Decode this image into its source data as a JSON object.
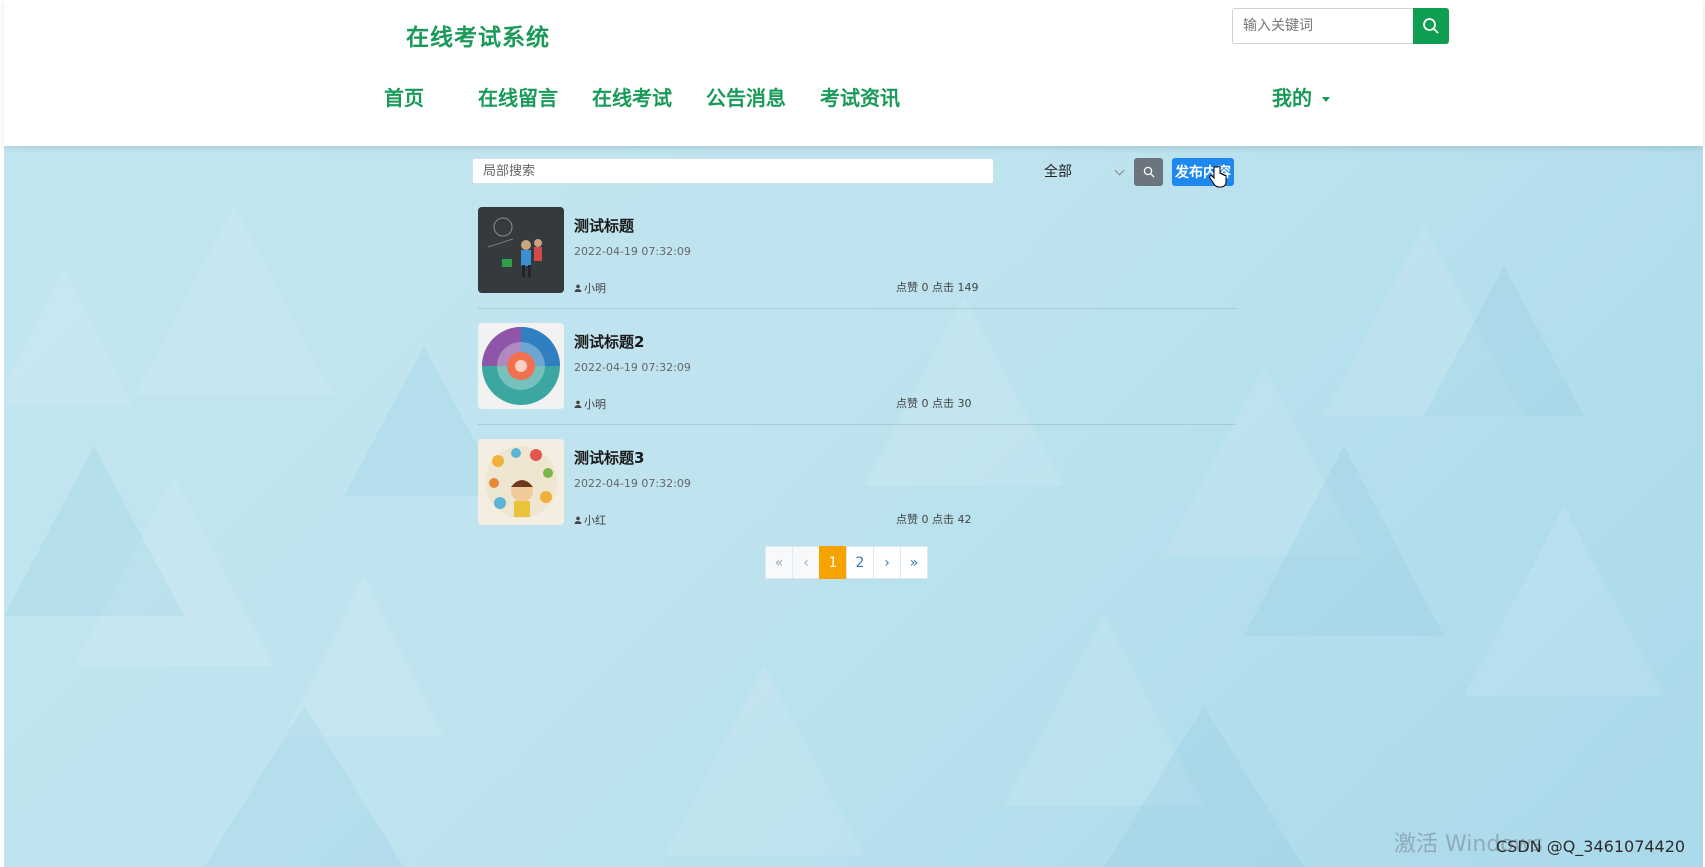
{
  "header": {
    "logo": "在线考试系统",
    "search_placeholder": "输入关键词",
    "nav": [
      "首页",
      "在线留言",
      "在线考试",
      "公告消息",
      "考试资讯"
    ],
    "mine": "我的"
  },
  "toolbar": {
    "local_search_placeholder": "局部搜索",
    "filter_value": "全部",
    "publish_label": "发布内容"
  },
  "posts": [
    {
      "title": "测试标题",
      "date": "2022-04-19 07:32:09",
      "author": "小明",
      "stats": "点赞 0 点击 149"
    },
    {
      "title": "测试标题2",
      "date": "2022-04-19 07:32:09",
      "author": "小明",
      "stats": "点赞 0 点击 30"
    },
    {
      "title": "测试标题3",
      "date": "2022-04-19 07:32:09",
      "author": "小红",
      "stats": "点赞 0 点击 42"
    }
  ],
  "pagination": {
    "first": "«",
    "prev": "‹",
    "pages": [
      "1",
      "2"
    ],
    "next": "›",
    "last": "»"
  },
  "overlay": {
    "watermark": "激活 Windows",
    "csdn": "CSDN @Q_3461074420"
  },
  "colors": {
    "brand_green": "#1a9a58",
    "publish_blue": "#1e88f0",
    "active_page": "#f6a300"
  }
}
